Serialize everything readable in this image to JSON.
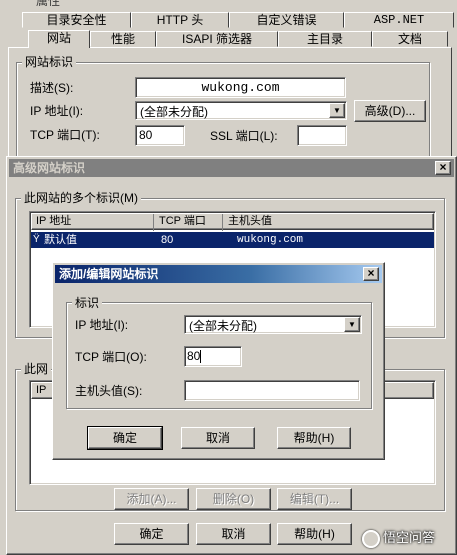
{
  "props_sheet": {
    "title_fragment": "属性",
    "tabs_row1": [
      "目录安全性",
      "HTTP 头",
      "自定义错误",
      "ASP.NET"
    ],
    "tabs_row2": [
      "网站",
      "性能",
      "ISAPI 筛选器",
      "主目录",
      "文档"
    ],
    "active_tab": "网站",
    "group_label": "网站标识",
    "desc_label": "描述(S):",
    "desc_value": "wukong.com",
    "ip_label": "IP 地址(I):",
    "ip_value": "(全部未分配)",
    "advanced_button": "高级(D)...",
    "tcp_label": "TCP 端口(T):",
    "tcp_value": "80",
    "ssl_label": "SSL 端口(L):",
    "ssl_value": ""
  },
  "advanced_dialog": {
    "title": "高级网站标识",
    "group1_label": "此网站的多个标识(M)",
    "columns": [
      "IP 地址",
      "TCP 端口",
      "主机头值"
    ],
    "rows": [
      {
        "ip": "默认值",
        "port": "80",
        "host": "wukong.com",
        "selected": true
      }
    ],
    "group2_label": "此网",
    "group2_col": "IP",
    "add_button": "添加(A)...",
    "delete_button": "删除(O)",
    "edit_button": "编辑(T)...",
    "ok_button": "确定",
    "cancel_button": "取消",
    "help_button": "帮助(H)"
  },
  "edit_dialog": {
    "title": "添加/编辑网站标识",
    "group_label": "标识",
    "ip_label": "IP 地址(I):",
    "ip_value": "(全部未分配)",
    "tcp_label": "TCP 端口(O):",
    "tcp_value": "80",
    "host_label": "主机头值(S):",
    "host_value": "",
    "ok_button": "确定",
    "cancel_button": "取消",
    "help_button": "帮助(H)"
  },
  "watermark": "悟空问答",
  "colors": {
    "face": "#d4d0c8",
    "title_active": "#0a246a",
    "title_inactive": "#808080",
    "selection": "#0a246a"
  }
}
